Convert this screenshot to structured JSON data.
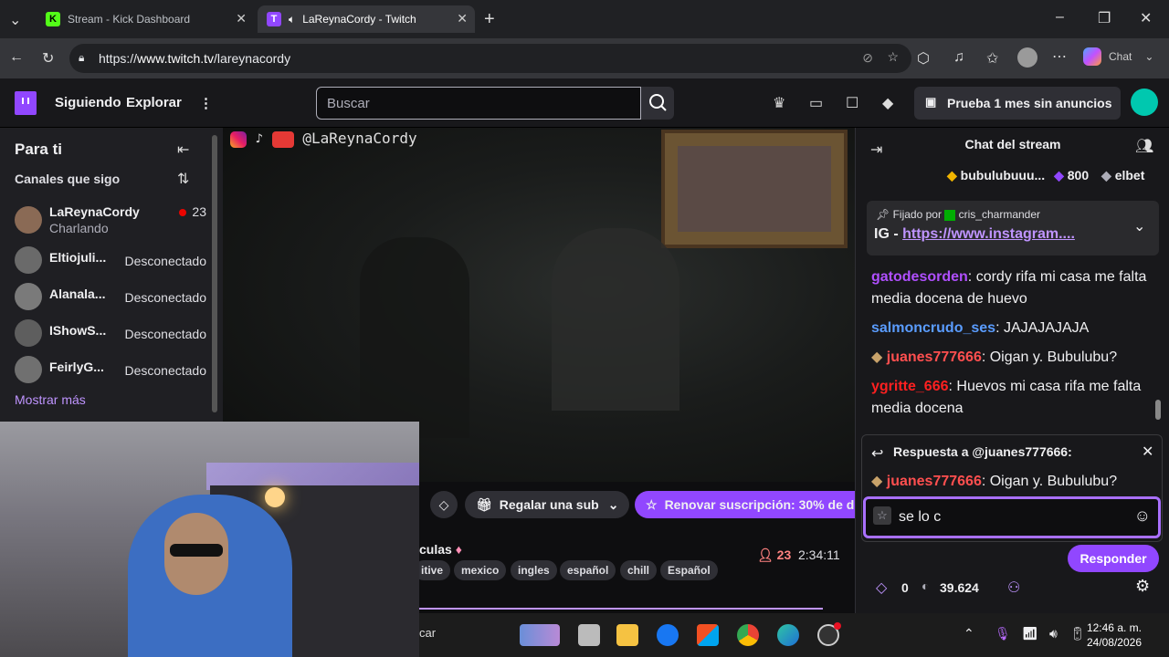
{
  "browser": {
    "tabs": [
      {
        "title": "Stream - Kick Dashboard",
        "favicon": "K"
      },
      {
        "title": "LaReynaCordy - Twitch",
        "favicon": "T"
      }
    ],
    "url_prefix": "https://",
    "url_host": "www.twitch.tv",
    "url_path": "/lareynacordy",
    "chat_label": "Chat"
  },
  "twitch_nav": {
    "following": "Siguiendo",
    "browse": "Explorar",
    "search_placeholder": "Buscar",
    "promo": "Prueba 1 mes sin anuncios"
  },
  "sidebar": {
    "title": "Para ti",
    "followed_header": "Canales que sigo",
    "channels": [
      {
        "name": "LaReynaCordy",
        "game": "Charlando",
        "status": "23",
        "live": true
      },
      {
        "name": "Eltiojuli...",
        "status": "Desconectado"
      },
      {
        "name": "Alanala...",
        "status": "Desconectado"
      },
      {
        "name": "IShowS...",
        "status": "Desconectado"
      },
      {
        "name": "FeirlyG...",
        "status": "Desconectado"
      }
    ],
    "show_more": "Mostrar más"
  },
  "video": {
    "handle": "@LaReynaCordy"
  },
  "infobar": {
    "gift_sub": "Regalar una sub",
    "renew": "Renovar suscripción: 30% de d",
    "title_fragment": "culas",
    "viewers": "23",
    "uptime": "2:34:11",
    "tags": [
      "itive",
      "mexico",
      "ingles",
      "español",
      "chill",
      "Español"
    ]
  },
  "chat": {
    "title": "Chat del stream",
    "gift_user": "bubulubuuu...",
    "gift_amount": "800",
    "gift_user2": "elbet",
    "pinned_by_label": "Fijado por",
    "pinned_by": "cris_charmander",
    "pinned_prefix": "IG -",
    "pinned_link": "https://www.instagram....",
    "messages": [
      {
        "user": "gatodesorden",
        "color": "#b04fff",
        "text": ": cordy rifa mi casa me falta media docena de huevo"
      },
      {
        "user": "salmoncrudo_ses",
        "color": "#5a9cff",
        "text": ": JAJAJAJAJA"
      },
      {
        "user": "juanes777666",
        "color": "#ff4f4f",
        "text": ": Oigan y. Bubulubu?"
      },
      {
        "user": "ygritte_666",
        "color": "#ff2020",
        "text": ": Huevos mi casa rifa me falta media docena"
      }
    ],
    "reply_header": "Respuesta a @juanes777666:",
    "reply_user": "juanes777666",
    "reply_text": ": Oigan y. Bubulubu?",
    "input_value": "se lo c",
    "respond_button": "Responder",
    "points_a": "0",
    "points_b": "39.624"
  },
  "taskbar": {
    "search_fragment": "car",
    "time": "12:46 a. m.",
    "date": "24/08/2026"
  }
}
